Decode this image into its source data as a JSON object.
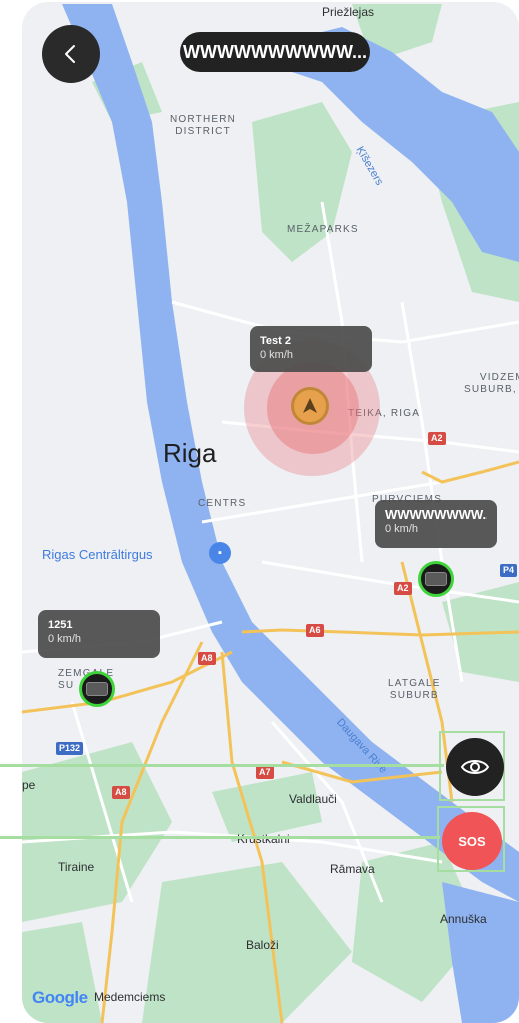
{
  "header": {
    "back_icon": "chevron-left-icon",
    "title": "WWWWWWWWWW..."
  },
  "map": {
    "city_label": "Riga",
    "district_labels": {
      "northern_district": "NORTHERN\nDISTRICT",
      "mezaparks": "MEŽAPARKS",
      "teika": "TEIKA, RIGA",
      "centrs": "CENTRS",
      "purvciems": "PURVCIEMS",
      "vidzeme_suburb": "VIDZEM\nSUBURB, I",
      "latgale_suburb": "LATGALE\nSUBURB",
      "zemgale_suburb": "ZEMGALE\nSU"
    },
    "place_labels": {
      "priezlejas": "Priežlejas",
      "market": "Rigas Centrāltirgus",
      "valdlauci": "Valdlauči",
      "krustkalni": "Krustkalni",
      "tiraine": "Tiraine",
      "ramava": "Rāmava",
      "annuska": "Annuška",
      "balozi": "Baloži",
      "medemciems": "Medemciems",
      "pe": "pe"
    },
    "water_labels": {
      "kisezers": "Ķīšezers",
      "daugava": "Daugava Rive"
    },
    "road_shields": {
      "a2_top": "A2",
      "a2_mid": "A2",
      "a6": "A6",
      "a8_center": "A8",
      "a8_left": "A8",
      "a7": "A7",
      "p132": "P132",
      "p4": "P4"
    },
    "attribution": "Google",
    "colors": {
      "land": "#eef0f3",
      "water": "#8fb3f0",
      "park": "#bfe3c6",
      "highway": "#f3c35a"
    }
  },
  "vehicles": {
    "self": {
      "name": "Test 2",
      "speed": "0 km/h",
      "icon": "navigation-arrow-icon"
    },
    "device_right": {
      "name": "WWWWWWWW...",
      "speed": "0 km/h"
    },
    "device_left": {
      "name": "1251",
      "speed": "0 km/h"
    }
  },
  "controls": {
    "visibility_icon": "eye-icon",
    "sos_label": "SOS",
    "accent_colors": {
      "sos": "#f05456",
      "online_ring": "#3fd43a",
      "guide": "#a6dda0"
    }
  }
}
